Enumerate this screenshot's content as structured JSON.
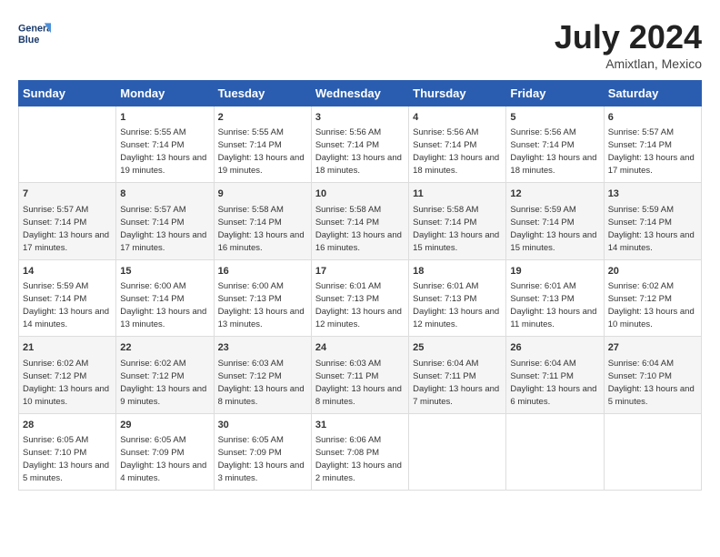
{
  "header": {
    "logo_line1": "General",
    "logo_line2": "Blue",
    "month": "July 2024",
    "location": "Amixtlan, Mexico"
  },
  "days_of_week": [
    "Sunday",
    "Monday",
    "Tuesday",
    "Wednesday",
    "Thursday",
    "Friday",
    "Saturday"
  ],
  "weeks": [
    [
      {
        "day": "",
        "sunrise": "",
        "sunset": "",
        "daylight": ""
      },
      {
        "day": "1",
        "sunrise": "Sunrise: 5:55 AM",
        "sunset": "Sunset: 7:14 PM",
        "daylight": "Daylight: 13 hours and 19 minutes."
      },
      {
        "day": "2",
        "sunrise": "Sunrise: 5:55 AM",
        "sunset": "Sunset: 7:14 PM",
        "daylight": "Daylight: 13 hours and 19 minutes."
      },
      {
        "day": "3",
        "sunrise": "Sunrise: 5:56 AM",
        "sunset": "Sunset: 7:14 PM",
        "daylight": "Daylight: 13 hours and 18 minutes."
      },
      {
        "day": "4",
        "sunrise": "Sunrise: 5:56 AM",
        "sunset": "Sunset: 7:14 PM",
        "daylight": "Daylight: 13 hours and 18 minutes."
      },
      {
        "day": "5",
        "sunrise": "Sunrise: 5:56 AM",
        "sunset": "Sunset: 7:14 PM",
        "daylight": "Daylight: 13 hours and 18 minutes."
      },
      {
        "day": "6",
        "sunrise": "Sunrise: 5:57 AM",
        "sunset": "Sunset: 7:14 PM",
        "daylight": "Daylight: 13 hours and 17 minutes."
      }
    ],
    [
      {
        "day": "7",
        "sunrise": "Sunrise: 5:57 AM",
        "sunset": "Sunset: 7:14 PM",
        "daylight": "Daylight: 13 hours and 17 minutes."
      },
      {
        "day": "8",
        "sunrise": "Sunrise: 5:57 AM",
        "sunset": "Sunset: 7:14 PM",
        "daylight": "Daylight: 13 hours and 17 minutes."
      },
      {
        "day": "9",
        "sunrise": "Sunrise: 5:58 AM",
        "sunset": "Sunset: 7:14 PM",
        "daylight": "Daylight: 13 hours and 16 minutes."
      },
      {
        "day": "10",
        "sunrise": "Sunrise: 5:58 AM",
        "sunset": "Sunset: 7:14 PM",
        "daylight": "Daylight: 13 hours and 16 minutes."
      },
      {
        "day": "11",
        "sunrise": "Sunrise: 5:58 AM",
        "sunset": "Sunset: 7:14 PM",
        "daylight": "Daylight: 13 hours and 15 minutes."
      },
      {
        "day": "12",
        "sunrise": "Sunrise: 5:59 AM",
        "sunset": "Sunset: 7:14 PM",
        "daylight": "Daylight: 13 hours and 15 minutes."
      },
      {
        "day": "13",
        "sunrise": "Sunrise: 5:59 AM",
        "sunset": "Sunset: 7:14 PM",
        "daylight": "Daylight: 13 hours and 14 minutes."
      }
    ],
    [
      {
        "day": "14",
        "sunrise": "Sunrise: 5:59 AM",
        "sunset": "Sunset: 7:14 PM",
        "daylight": "Daylight: 13 hours and 14 minutes."
      },
      {
        "day": "15",
        "sunrise": "Sunrise: 6:00 AM",
        "sunset": "Sunset: 7:14 PM",
        "daylight": "Daylight: 13 hours and 13 minutes."
      },
      {
        "day": "16",
        "sunrise": "Sunrise: 6:00 AM",
        "sunset": "Sunset: 7:13 PM",
        "daylight": "Daylight: 13 hours and 13 minutes."
      },
      {
        "day": "17",
        "sunrise": "Sunrise: 6:01 AM",
        "sunset": "Sunset: 7:13 PM",
        "daylight": "Daylight: 13 hours and 12 minutes."
      },
      {
        "day": "18",
        "sunrise": "Sunrise: 6:01 AM",
        "sunset": "Sunset: 7:13 PM",
        "daylight": "Daylight: 13 hours and 12 minutes."
      },
      {
        "day": "19",
        "sunrise": "Sunrise: 6:01 AM",
        "sunset": "Sunset: 7:13 PM",
        "daylight": "Daylight: 13 hours and 11 minutes."
      },
      {
        "day": "20",
        "sunrise": "Sunrise: 6:02 AM",
        "sunset": "Sunset: 7:12 PM",
        "daylight": "Daylight: 13 hours and 10 minutes."
      }
    ],
    [
      {
        "day": "21",
        "sunrise": "Sunrise: 6:02 AM",
        "sunset": "Sunset: 7:12 PM",
        "daylight": "Daylight: 13 hours and 10 minutes."
      },
      {
        "day": "22",
        "sunrise": "Sunrise: 6:02 AM",
        "sunset": "Sunset: 7:12 PM",
        "daylight": "Daylight: 13 hours and 9 minutes."
      },
      {
        "day": "23",
        "sunrise": "Sunrise: 6:03 AM",
        "sunset": "Sunset: 7:12 PM",
        "daylight": "Daylight: 13 hours and 8 minutes."
      },
      {
        "day": "24",
        "sunrise": "Sunrise: 6:03 AM",
        "sunset": "Sunset: 7:11 PM",
        "daylight": "Daylight: 13 hours and 8 minutes."
      },
      {
        "day": "25",
        "sunrise": "Sunrise: 6:04 AM",
        "sunset": "Sunset: 7:11 PM",
        "daylight": "Daylight: 13 hours and 7 minutes."
      },
      {
        "day": "26",
        "sunrise": "Sunrise: 6:04 AM",
        "sunset": "Sunset: 7:11 PM",
        "daylight": "Daylight: 13 hours and 6 minutes."
      },
      {
        "day": "27",
        "sunrise": "Sunrise: 6:04 AM",
        "sunset": "Sunset: 7:10 PM",
        "daylight": "Daylight: 13 hours and 5 minutes."
      }
    ],
    [
      {
        "day": "28",
        "sunrise": "Sunrise: 6:05 AM",
        "sunset": "Sunset: 7:10 PM",
        "daylight": "Daylight: 13 hours and 5 minutes."
      },
      {
        "day": "29",
        "sunrise": "Sunrise: 6:05 AM",
        "sunset": "Sunset: 7:09 PM",
        "daylight": "Daylight: 13 hours and 4 minutes."
      },
      {
        "day": "30",
        "sunrise": "Sunrise: 6:05 AM",
        "sunset": "Sunset: 7:09 PM",
        "daylight": "Daylight: 13 hours and 3 minutes."
      },
      {
        "day": "31",
        "sunrise": "Sunrise: 6:06 AM",
        "sunset": "Sunset: 7:08 PM",
        "daylight": "Daylight: 13 hours and 2 minutes."
      },
      {
        "day": "",
        "sunrise": "",
        "sunset": "",
        "daylight": ""
      },
      {
        "day": "",
        "sunrise": "",
        "sunset": "",
        "daylight": ""
      },
      {
        "day": "",
        "sunrise": "",
        "sunset": "",
        "daylight": ""
      }
    ]
  ]
}
